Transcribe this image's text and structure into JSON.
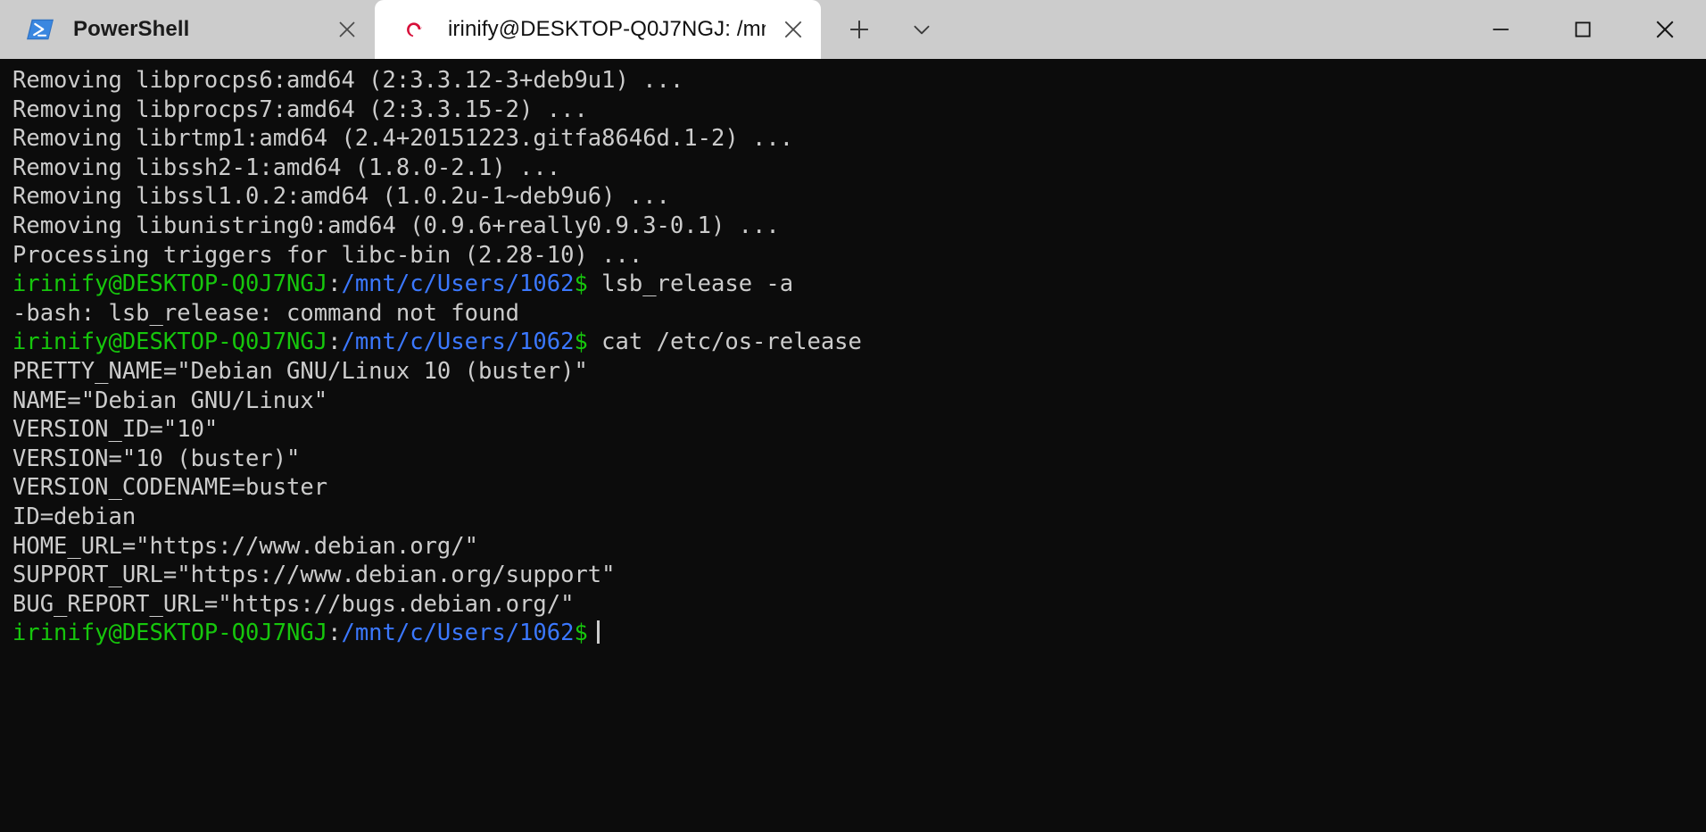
{
  "window": {
    "controls": {
      "minimize_label": "Minimize",
      "maximize_label": "Maximize",
      "close_label": "Close"
    }
  },
  "tabbar": {
    "tabs": [
      {
        "title": "PowerShell",
        "icon": "powershell-icon",
        "active": false,
        "close_label": "Close tab"
      },
      {
        "title": "irinify@DESKTOP-Q0J7NGJ: /mn",
        "icon": "debian-icon",
        "active": true,
        "close_label": "Close tab"
      }
    ],
    "new_tab_label": "New tab",
    "dropdown_label": "Open dropdown"
  },
  "colors": {
    "terminal_background": "#0c0c0c",
    "terminal_foreground": "#cccccc",
    "prompt_user_host": "#16c60c",
    "prompt_path": "#3b78ff",
    "titlebar_background": "#cccccc",
    "active_tab_background": "#ffffff"
  },
  "terminal": {
    "user": "irinify",
    "host": "DESKTOP-Q0J7NGJ",
    "cwd": "/mnt/c/Users/1062",
    "prompt_symbol": "$",
    "lines": [
      {
        "type": "output",
        "text": "Removing libprocps6:amd64 (2:3.3.12-3+deb9u1) ..."
      },
      {
        "type": "output",
        "text": "Removing libprocps7:amd64 (2:3.3.15-2) ..."
      },
      {
        "type": "output",
        "text": "Removing librtmp1:amd64 (2.4+20151223.gitfa8646d.1-2) ..."
      },
      {
        "type": "output",
        "text": "Removing libssh2-1:amd64 (1.8.0-2.1) ..."
      },
      {
        "type": "output",
        "text": "Removing libssl1.0.2:amd64 (1.0.2u-1~deb9u6) ..."
      },
      {
        "type": "output",
        "text": "Removing libunistring0:amd64 (0.9.6+really0.9.3-0.1) ..."
      },
      {
        "type": "output",
        "text": "Processing triggers for libc-bin (2.28-10) ..."
      },
      {
        "type": "prompt",
        "command": "lsb_release -a"
      },
      {
        "type": "output",
        "text": "-bash: lsb_release: command not found"
      },
      {
        "type": "prompt",
        "command": "cat /etc/os-release"
      },
      {
        "type": "output",
        "text": "PRETTY_NAME=\"Debian GNU/Linux 10 (buster)\""
      },
      {
        "type": "output",
        "text": "NAME=\"Debian GNU/Linux\""
      },
      {
        "type": "output",
        "text": "VERSION_ID=\"10\""
      },
      {
        "type": "output",
        "text": "VERSION=\"10 (buster)\""
      },
      {
        "type": "output",
        "text": "VERSION_CODENAME=buster"
      },
      {
        "type": "output",
        "text": "ID=debian"
      },
      {
        "type": "output",
        "text": "HOME_URL=\"https://www.debian.org/\""
      },
      {
        "type": "output",
        "text": "SUPPORT_URL=\"https://www.debian.org/support\""
      },
      {
        "type": "output",
        "text": "BUG_REPORT_URL=\"https://bugs.debian.org/\""
      },
      {
        "type": "prompt",
        "command": "",
        "cursor": true
      }
    ]
  }
}
